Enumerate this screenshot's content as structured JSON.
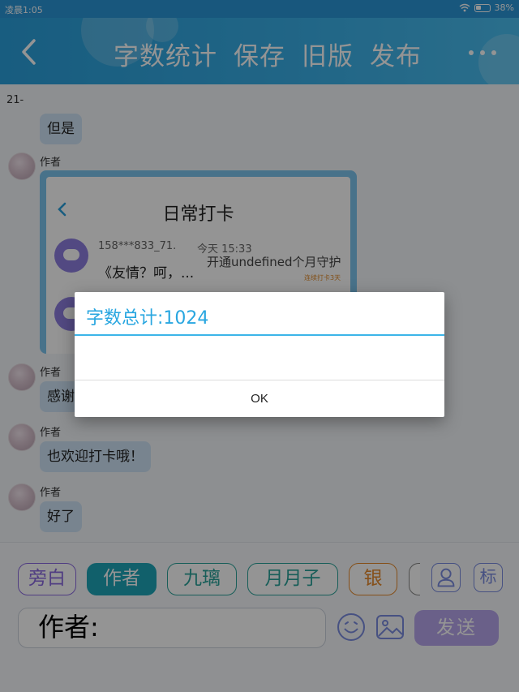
{
  "status_bar": {
    "time": "凌晨1:05",
    "battery": "38%"
  },
  "header": {
    "actions": [
      {
        "id": "word-count",
        "label": "字数统计"
      },
      {
        "id": "save",
        "label": "保存"
      },
      {
        "id": "old-version",
        "label": "旧版"
      },
      {
        "id": "publish",
        "label": "发布"
      }
    ]
  },
  "chat": {
    "chapter_label": "21-",
    "messages": [
      {
        "text": "但是"
      },
      {
        "author": "作者"
      },
      {
        "author": "作者",
        "text": "感谢"
      },
      {
        "author": "作者",
        "text": "也欢迎打卡哦！"
      },
      {
        "author": "作者",
        "text": "好了"
      }
    ],
    "embedded_screenshot": {
      "title": "日常打卡",
      "user": "158***833_71.",
      "time": "今天 15:33",
      "guard_text": "开通undefined个月守护",
      "snippet": "《友情？呵，...",
      "streak_badge": "连续打卡3天"
    }
  },
  "composer": {
    "chips": [
      {
        "label": "旁白",
        "color": "#8a6ae0",
        "selected": false
      },
      {
        "label": "作者",
        "color": "#1ea6b8",
        "selected": true
      },
      {
        "label": "九璃",
        "color": "#2aa39a",
        "selected": false
      },
      {
        "label": "月月子",
        "color": "#2aa39a",
        "selected": false
      },
      {
        "label": "银",
        "color": "#e68a2e",
        "selected": false
      }
    ],
    "tag_label": "标",
    "input_value": "作者:",
    "send_label": "发送"
  },
  "dialog": {
    "title": "字数总计:1024",
    "ok_label": "OK"
  }
}
